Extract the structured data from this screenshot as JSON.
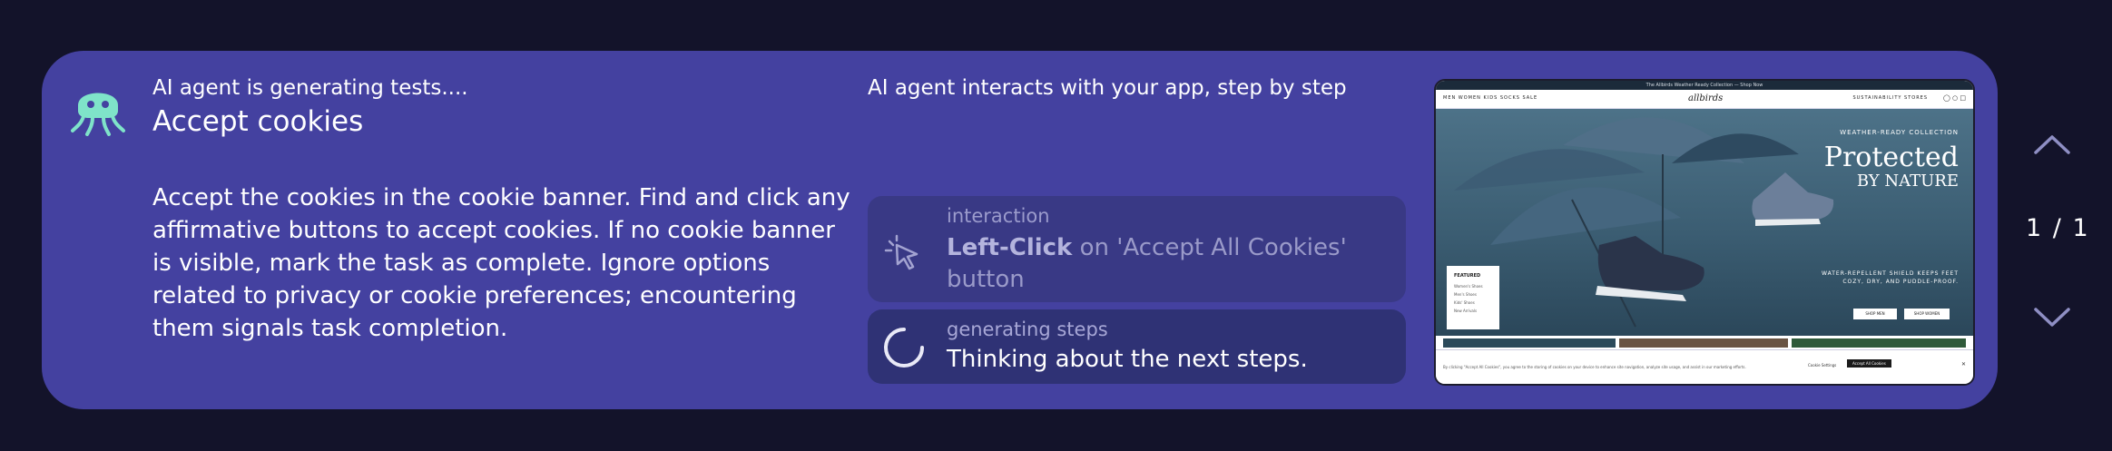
{
  "agent": {
    "status": "AI agent is generating tests....",
    "task_title": "Accept cookies",
    "task_description": "Accept the cookies in the cookie banner. Find and click any affirmative buttons to accept cookies. If no cookie banner is visible, mark the task as complete. Ignore options related to privacy or cookie preferences; encountering them signals task completion."
  },
  "steps_panel": {
    "heading": "AI agent interacts with your app, step by step",
    "steps": [
      {
        "kind": "interaction",
        "icon": "cursor-click-icon",
        "action": "Left-Click",
        "detail": " on 'Accept All Cookies' button"
      },
      {
        "kind": "generating steps",
        "icon": "loading-spinner-icon",
        "text": "Thinking about the next steps."
      }
    ]
  },
  "preview": {
    "promo_bar": "The Allbirds Weather Ready Collection — Shop Now",
    "nav_left": "MEN   WOMEN   KIDS   SOCKS   SALE",
    "logo": "allbirds",
    "nav_right": "SUSTAINABILITY   STORES",
    "hero": {
      "kicker": "WEATHER-READY COLLECTION",
      "title": "Protected",
      "subtitle": "BY NATURE",
      "tagline": "WATER-REPELLENT SHIELD KEEPS FEET COZY, DRY, AND PUDDLE-PROOF.",
      "shop_men": "SHOP MEN",
      "shop_women": "SHOP WOMEN"
    },
    "featured": {
      "title": "FEATURED",
      "items": [
        "Women's Shoes",
        "Men's Shoes",
        "Kids' Shoes",
        "New Arrivals"
      ]
    },
    "cookie_banner": {
      "text": "By clicking \"Accept All Cookies\", you agree to the storing of cookies on your device to enhance site navigation, analyze site usage, and assist in our marketing efforts.",
      "settings": "Cookie Settings",
      "accept": "Accept All Cookies"
    }
  },
  "pager": {
    "count": "1 / 1"
  },
  "colors": {
    "page_bg": "#13132a",
    "card_bg": "#4441a0",
    "step_bg": "#393985",
    "accent_mint": "#7fe3c9"
  }
}
